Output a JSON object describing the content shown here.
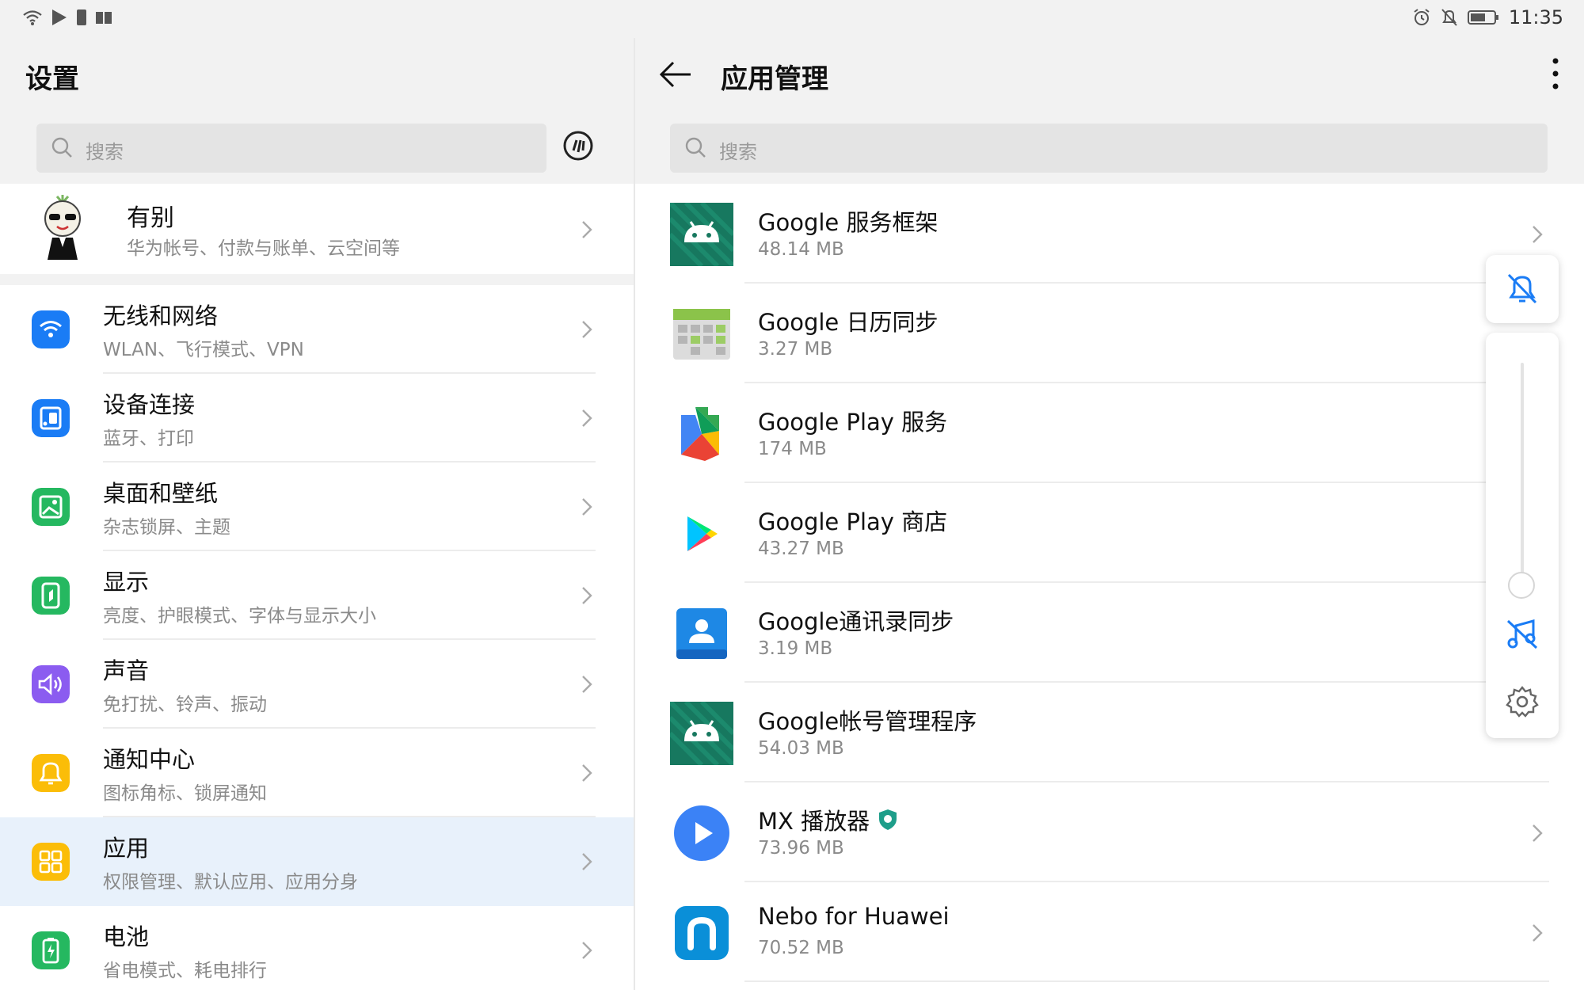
{
  "status_bar": {
    "time": "11:35",
    "left_icons": [
      "wifi-icon",
      "play-store-icon",
      "sim-icon",
      "book-icon"
    ],
    "right_icons": [
      "alarm-icon",
      "mute-bell-icon",
      "battery-icon"
    ]
  },
  "left_pane": {
    "title": "设置",
    "search": {
      "placeholder": "搜索"
    },
    "account": {
      "name": "有别",
      "subtitle": "华为帐号、付款与账单、云空间等"
    },
    "items": [
      {
        "title": "无线和网络",
        "subtitle": "WLAN、飞行模式、VPN",
        "icon": "wifi-icon",
        "color": "#1a7cf5"
      },
      {
        "title": "设备连接",
        "subtitle": "蓝牙、打印",
        "icon": "device-connect-icon",
        "color": "#1a7cf5"
      },
      {
        "title": "桌面和壁纸",
        "subtitle": "杂志锁屏、主题",
        "icon": "wallpaper-icon",
        "color": "#25b860"
      },
      {
        "title": "显示",
        "subtitle": "亮度、护眼模式、字体与显示大小",
        "icon": "display-icon",
        "color": "#25b860"
      },
      {
        "title": "声音",
        "subtitle": "免打扰、铃声、振动",
        "icon": "sound-icon",
        "color": "#8b5cf0"
      },
      {
        "title": "通知中心",
        "subtitle": "图标角标、锁屏通知",
        "icon": "notification-icon",
        "color": "#fbbd08"
      },
      {
        "title": "应用",
        "subtitle": "权限管理、默认应用、应用分身",
        "icon": "apps-icon",
        "color": "#fbbd08"
      },
      {
        "title": "电池",
        "subtitle": "省电模式、耗电排行",
        "icon": "battery-icon",
        "color": "#25b860"
      }
    ]
  },
  "right_pane": {
    "title": "应用管理",
    "search": {
      "placeholder": "搜索"
    },
    "apps": [
      {
        "name": "Google 服务框架",
        "size": "48.14 MB",
        "icon": "android-icon"
      },
      {
        "name": "Google 日历同步",
        "size": "3.27 MB",
        "icon": "calendar-sync-icon"
      },
      {
        "name": "Google Play 服务",
        "size": "174 MB",
        "icon": "play-services-icon"
      },
      {
        "name": "Google Play 商店",
        "size": "43.27 MB",
        "icon": "play-store-icon"
      },
      {
        "name": "Google通讯录同步",
        "size": "3.19 MB",
        "icon": "contacts-sync-icon"
      },
      {
        "name": "Google帐号管理程序",
        "size": "54.03 MB",
        "icon": "android-icon"
      },
      {
        "name": "MX 播放器",
        "size": "73.96 MB",
        "icon": "mx-player-icon"
      },
      {
        "name": "Nebo for Huawei",
        "size": "70.52 MB",
        "icon": "nebo-icon"
      }
    ]
  },
  "volume_panel": {
    "level": 0.0,
    "icons": [
      "mute-bell-icon",
      "music-off-icon",
      "gear-icon"
    ],
    "accent": "#1a7cf5"
  }
}
